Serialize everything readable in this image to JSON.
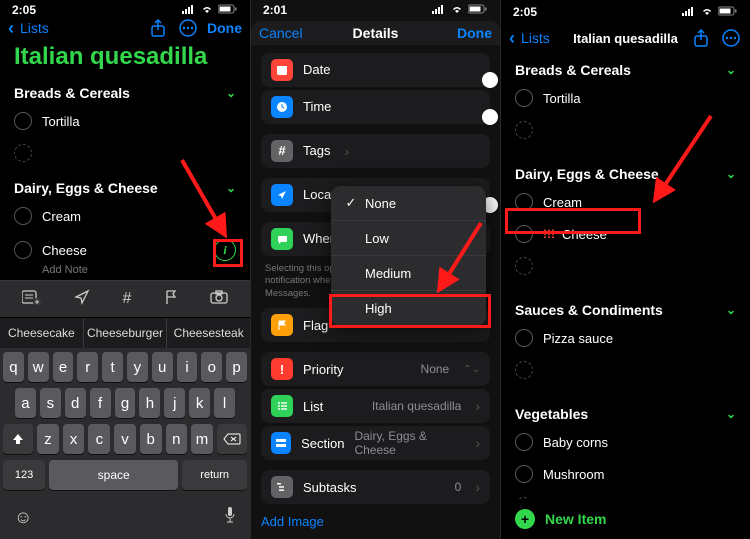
{
  "panel1": {
    "time": "2:05",
    "back": "Lists",
    "done": "Done",
    "title": "Italian quesadilla",
    "sections": [
      {
        "name": "Breads & Cereals",
        "items": [
          "Tortilla"
        ]
      },
      {
        "name": "Dairy, Eggs & Cheese",
        "items": [
          "Cream",
          "Cheese"
        ]
      }
    ],
    "addnote": "Add Note",
    "predictions": [
      "Cheesecake",
      "Cheeseburger",
      "Cheesesteak"
    ],
    "keyboard": {
      "row1": [
        "q",
        "w",
        "e",
        "r",
        "t",
        "y",
        "u",
        "i",
        "o",
        "p"
      ],
      "row2": [
        "a",
        "s",
        "d",
        "f",
        "g",
        "h",
        "j",
        "k",
        "l"
      ],
      "row3": [
        "z",
        "x",
        "c",
        "v",
        "b",
        "n",
        "m"
      ],
      "n123": "123",
      "space": "space",
      "return": "return"
    }
  },
  "panel2": {
    "time": "2:01",
    "cancel": "Cancel",
    "title": "Details",
    "done": "Done",
    "rows": {
      "date": "Date",
      "time": "Time",
      "tags": "Tags",
      "location": "Location",
      "messaging": "When Messaging",
      "messaging_sub": "Selecting this option will show the reminder notification when chatting with a person in Messages.",
      "flag": "Flag",
      "priority": "Priority",
      "priority_val": "None",
      "list": "List",
      "list_val": "Italian quesadilla",
      "section": "Section",
      "section_val": "Dairy, Eggs & Cheese",
      "subtasks": "Subtasks",
      "subtasks_val": "0",
      "addimage": "Add Image"
    },
    "menu": {
      "none": "None",
      "low": "Low",
      "medium": "Medium",
      "high": "High"
    }
  },
  "panel3": {
    "time": "2:05",
    "back": "Lists",
    "title": "Italian quesadilla",
    "sections": [
      {
        "name": "Breads & Cereals",
        "items": [
          {
            "t": "Tortilla"
          }
        ]
      },
      {
        "name": "Dairy, Eggs & Cheese",
        "items": [
          {
            "t": "Cream"
          },
          {
            "t": "Cheese",
            "priority": "!!!"
          }
        ]
      },
      {
        "name": "Sauces & Condiments",
        "items": [
          {
            "t": "Pizza sauce"
          }
        ]
      },
      {
        "name": "Vegetables",
        "items": [
          {
            "t": "Baby corns"
          },
          {
            "t": "Mushroom"
          }
        ]
      }
    ],
    "newitem": "New Item"
  }
}
